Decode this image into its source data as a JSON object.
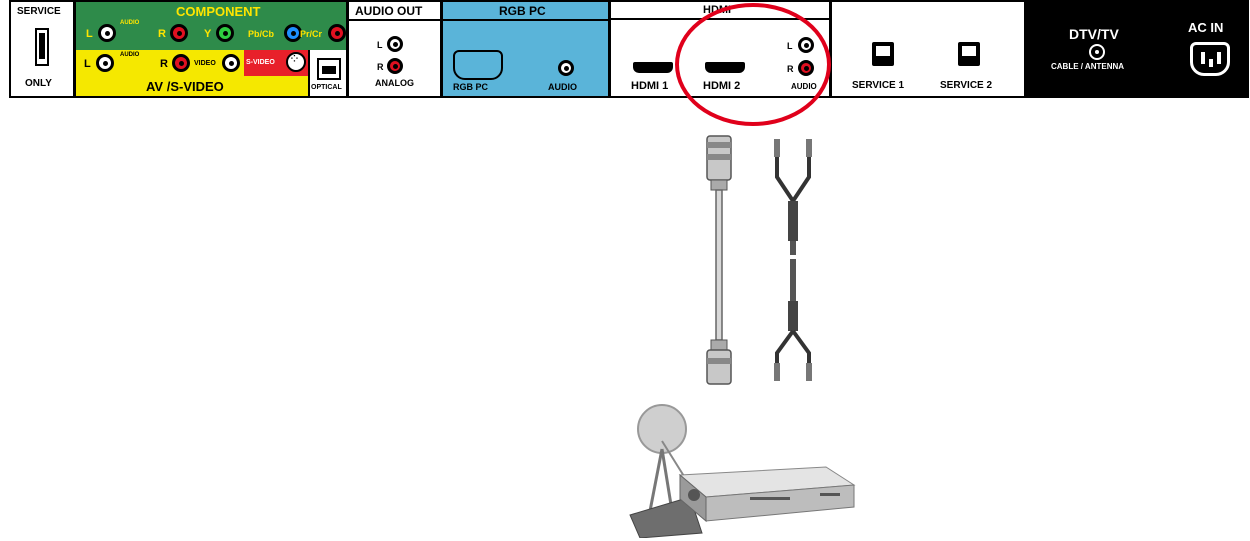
{
  "panel": {
    "service": {
      "top_label": "SERVICE",
      "bottom_label": "ONLY"
    },
    "component": {
      "title": "COMPONENT",
      "audio_label": "AUDIO",
      "l": "L",
      "r": "R",
      "y": "Y",
      "pb": "Pb/Cb",
      "pr": "Pr/Cr"
    },
    "av": {
      "audio_label": "AUDIO",
      "l": "L",
      "r": "R",
      "video": "VIDEO",
      "svideo": "S-VIDEO",
      "title": "AV /S-VIDEO",
      "optical": "OPTICAL"
    },
    "audio_out": {
      "title": "AUDIO OUT",
      "l": "L",
      "r": "R",
      "analog": "ANALOG"
    },
    "rgb": {
      "title": "RGB PC",
      "port_label": "RGB PC",
      "audio": "AUDIO"
    },
    "hdmi": {
      "title": "HDMI",
      "port1": "HDMI 1",
      "port2": "HDMI 2",
      "l": "L",
      "r": "R",
      "audio": "AUDIO"
    },
    "service_ports": {
      "s1": "SERVICE 1",
      "s2": "SERVICE 2"
    },
    "dtv": {
      "title": "DTV/TV",
      "subtitle": "CABLE / ANTENNA"
    },
    "ac": {
      "title": "AC IN"
    }
  },
  "colors": {
    "component_green": "#2e8b4a",
    "av_yellow": "#f5e800",
    "svideo_red": "#e8202a",
    "rgb_blue": "#5ab4d9",
    "highlight_red": "#e0001b"
  },
  "illustration": {
    "items": [
      "hdmi-cable",
      "rca-audio-cable",
      "set-top-box-with-dish"
    ]
  }
}
